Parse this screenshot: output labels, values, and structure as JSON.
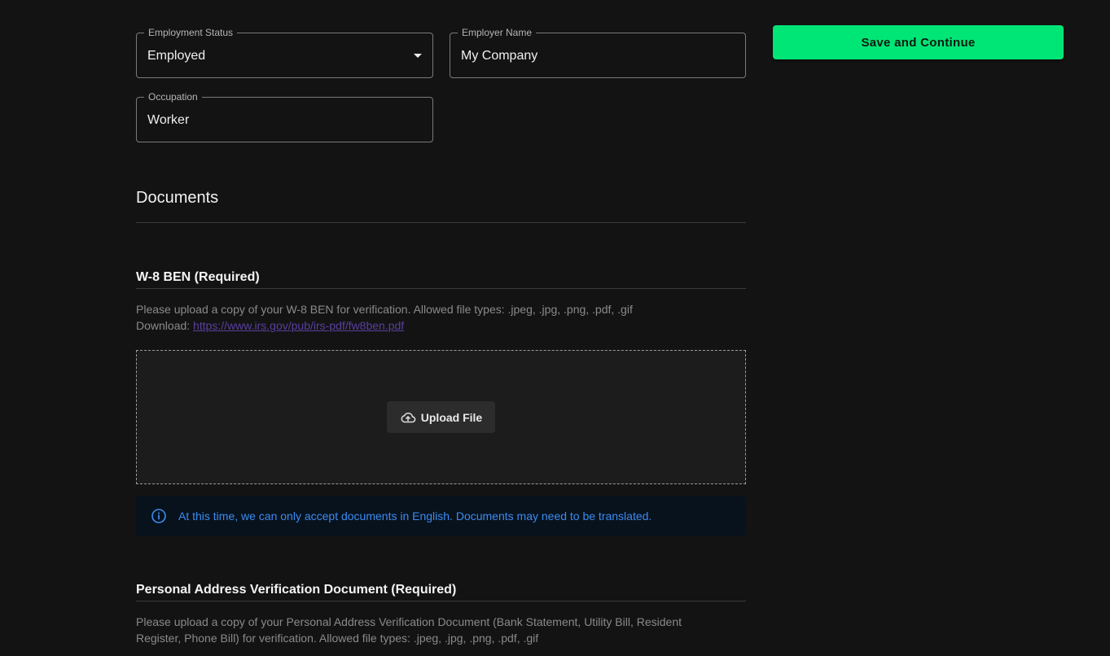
{
  "employment": {
    "status": {
      "label": "Employment Status",
      "value": "Employed"
    },
    "employer": {
      "label": "Employer Name",
      "value": "My Company"
    },
    "occupation": {
      "label": "Occupation",
      "value": "Worker"
    }
  },
  "actions": {
    "save_label": "Save and Continue"
  },
  "documents": {
    "title": "Documents",
    "w8ben": {
      "title": "W-8 BEN (Required)",
      "description": "Please upload a copy of your W-8 BEN for verification. Allowed file types: .jpeg, .jpg, .png, .pdf, .gif",
      "download_prefix": "Download: ",
      "download_link": "https://www.irs.gov/pub/irs-pdf/fw8ben.pdf",
      "upload_label": "Upload File",
      "info": "At this time, we can only accept documents in English. Documents may need to be translated."
    },
    "address": {
      "title": "Personal Address Verification Document (Required)",
      "description": "Please upload a copy of your Personal Address Verification Document (Bank Statement, Utility Bill, Resident Register, Phone Bill) for verification. Allowed file types: .jpeg, .jpg, .png, .pdf, .gif"
    }
  },
  "colors": {
    "background": "#131313",
    "accent": "#00e676",
    "info_text": "#3d8bf0",
    "info_background": "#07121d",
    "link": "#5a3f9e"
  },
  "icons": {
    "dropdown": "chevron-down-icon",
    "upload": "cloud-upload-icon",
    "info": "info-icon"
  }
}
